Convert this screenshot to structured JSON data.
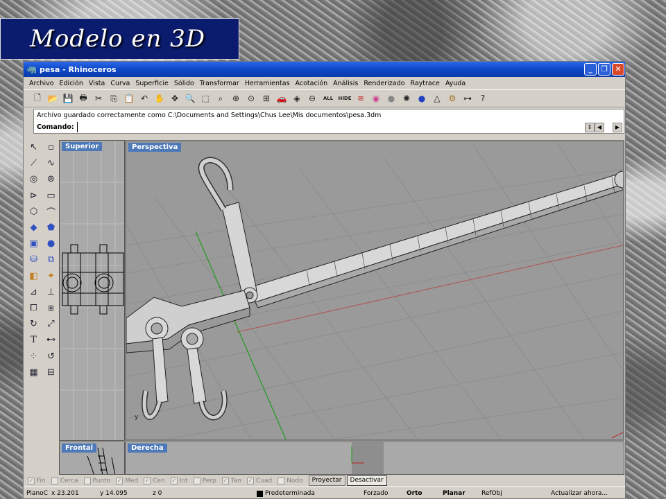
{
  "slide": {
    "title": "Modelo en 3D"
  },
  "window": {
    "title": "pesa - Rhinoceros",
    "buttons": {
      "minimize": "_",
      "maximize": "❐",
      "close": "✕"
    }
  },
  "menu": [
    "Archivo",
    "Edición",
    "Vista",
    "Curva",
    "Superficie",
    "Sólido",
    "Transformar",
    "Herramientas",
    "Acotación",
    "Análisis",
    "Renderizado",
    "Raytrace",
    "Ayuda"
  ],
  "toolbar": {
    "all_label": "ALL",
    "hide_label": "HIDE",
    "help_label": "?"
  },
  "command": {
    "history": "Archivo guardado correctamente como C:\\Documents and Settings\\Chus Lee\\Mis documentos\\pesa.3dm",
    "label": "Comando:",
    "value": ""
  },
  "viewports": {
    "top": "Superior",
    "perspective": "Perspectiva",
    "front": "Frontal",
    "right": "Derecha"
  },
  "osnaps": [
    {
      "label": "Fin",
      "checked": true
    },
    {
      "label": "Cerca",
      "checked": false
    },
    {
      "label": "Punto",
      "checked": false
    },
    {
      "label": "Med",
      "checked": true
    },
    {
      "label": "Cen",
      "checked": true
    },
    {
      "label": "Int",
      "checked": true
    },
    {
      "label": "Perp",
      "checked": false
    },
    {
      "label": "Tan",
      "checked": true
    },
    {
      "label": "Cuad",
      "checked": true
    },
    {
      "label": "Nodo",
      "checked": false
    }
  ],
  "osnap_buttons": {
    "project": "Proyectar",
    "disable": "Desactivar"
  },
  "status": {
    "cplane": "PlanoC",
    "x": "x 23.201",
    "y": "y 14.095",
    "z": "z 0",
    "layer": "Predeterminada",
    "snap": "Forzado",
    "ortho": "Orto",
    "planar": "Planar",
    "osnap": "RefObj",
    "update": "Actualizar ahora..."
  },
  "colors": {
    "title_bg": "#0b1b6e",
    "viewport_label": "#4d79b8",
    "x_axis": "#c02020",
    "y_axis": "#1f9a1f"
  }
}
